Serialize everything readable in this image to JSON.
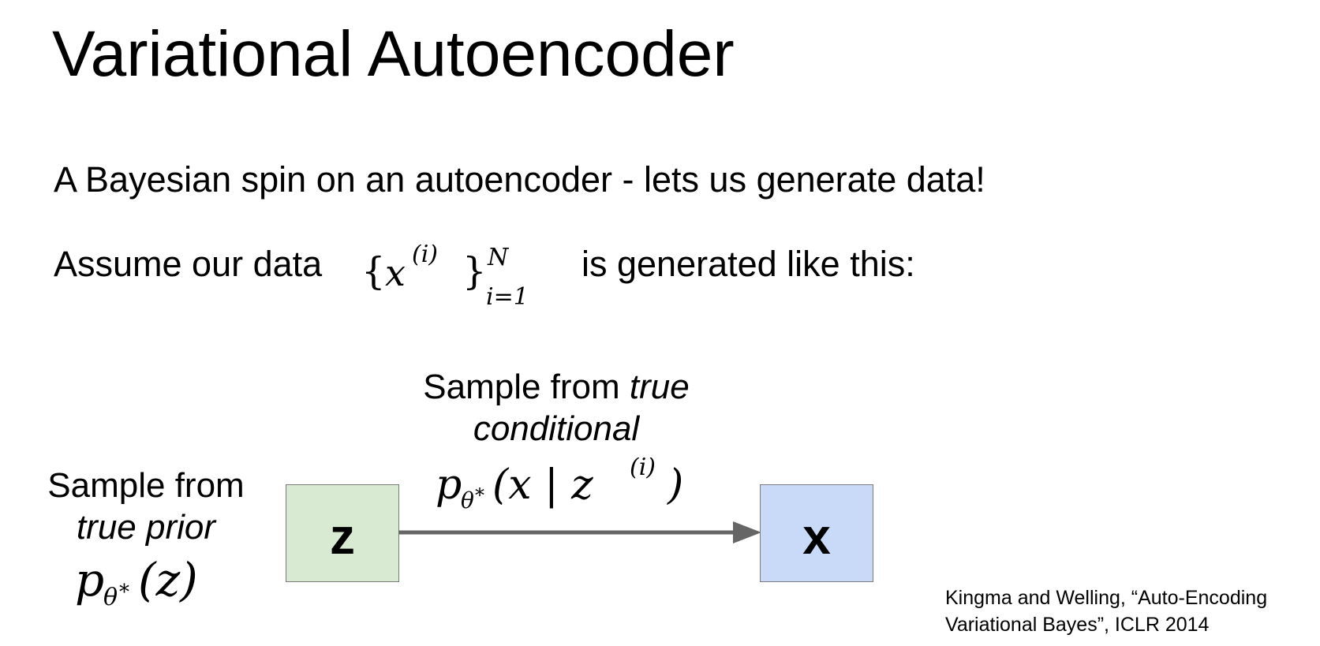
{
  "slide": {
    "title": "Variational Autoencoder",
    "line1": "A Bayesian spin on an autoencoder - lets us generate data!",
    "line2_before": "Assume our data",
    "line2_after": "is generated like this:"
  },
  "math": {
    "data_set": {
      "base": "x",
      "superscript": "(i)",
      "upper": "N",
      "lower": "i=1"
    },
    "prior": {
      "p": "p",
      "sub": "θ",
      "star": "*",
      "arg": "(z)"
    },
    "conditional": {
      "p": "p",
      "sub": "θ",
      "star": "*",
      "arg": "(x | z",
      "arg_sup": "(i)",
      "close": ")"
    }
  },
  "diagram": {
    "prior_label_line1": "Sample from",
    "prior_label_line2": "true prior",
    "conditional_label_line1_plain": "Sample from ",
    "conditional_label_line1_italic": "true",
    "conditional_label_line2": "conditional",
    "nodes": [
      {
        "label": "z",
        "color": "#d9ead3"
      },
      {
        "label": "x",
        "color": "#c9daf8"
      }
    ],
    "edge_color": "#666666"
  },
  "citation": {
    "line1": "Kingma and Welling, “Auto-Encoding",
    "line2": "Variational Bayes”, ICLR 2014"
  }
}
